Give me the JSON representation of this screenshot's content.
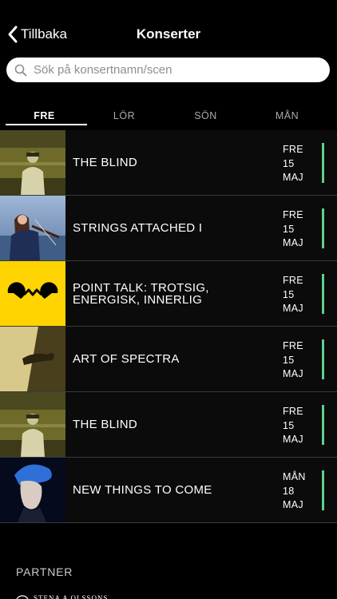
{
  "nav": {
    "back_label": "Tillbaka",
    "title": "Konserter"
  },
  "search": {
    "placeholder": "Sök på konsertnamn/scen",
    "value": ""
  },
  "tabs": [
    {
      "label": "FRE",
      "active": true
    },
    {
      "label": "LÖR",
      "active": false
    },
    {
      "label": "SÖN",
      "active": false
    },
    {
      "label": "MÅN",
      "active": false
    }
  ],
  "concerts": [
    {
      "title": "THE BLIND",
      "day": "FRE",
      "date": "15",
      "month": "MAJ"
    },
    {
      "title": "STRINGS ATTACHED I",
      "day": "FRE",
      "date": "15",
      "month": "MAJ"
    },
    {
      "title": "POINT TALK: TROTSIG, ENERGISK, INNERLIG",
      "day": "FRE",
      "date": "15",
      "month": "MAJ"
    },
    {
      "title": "ART OF SPECTRA",
      "day": "FRE",
      "date": "15",
      "month": "MAJ"
    },
    {
      "title": "THE BLIND",
      "day": "FRE",
      "date": "15",
      "month": "MAJ"
    },
    {
      "title": "NEW THINGS TO COME",
      "day": "MÅN",
      "date": "18",
      "month": "MAJ"
    }
  ],
  "partner": {
    "heading": "PARTNER",
    "logo_text": "STENA A OLSSONS"
  },
  "colors": {
    "accent": "#5fd08d",
    "background": "#000000",
    "row_background": "#0b0b0b"
  }
}
